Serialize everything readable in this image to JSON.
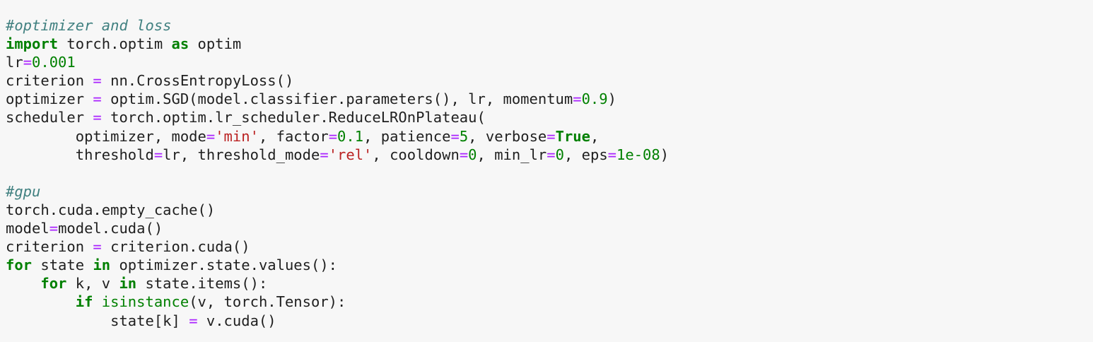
{
  "theme": {
    "background": "#f7f7f7",
    "text": "#1f1f1f",
    "comment": "#408080",
    "keyword": "#008000",
    "operator": "#aa22ff",
    "number": "#008000",
    "string": "#ba2121"
  },
  "code": {
    "language": "python",
    "lines": [
      [
        {
          "t": "comment",
          "v": "#optimizer and loss"
        }
      ],
      [
        {
          "t": "keyword",
          "v": "import"
        },
        {
          "t": "plain",
          "v": " torch.optim "
        },
        {
          "t": "keyword",
          "v": "as"
        },
        {
          "t": "plain",
          "v": " optim"
        }
      ],
      [
        {
          "t": "plain",
          "v": "lr"
        },
        {
          "t": "operator",
          "v": "="
        },
        {
          "t": "number",
          "v": "0.001"
        }
      ],
      [
        {
          "t": "plain",
          "v": "criterion "
        },
        {
          "t": "operator",
          "v": "="
        },
        {
          "t": "plain",
          "v": " nn.CrossEntropyLoss()"
        }
      ],
      [
        {
          "t": "plain",
          "v": "optimizer "
        },
        {
          "t": "operator",
          "v": "="
        },
        {
          "t": "plain",
          "v": " optim.SGD(model.classifier.parameters(), lr, momentum"
        },
        {
          "t": "operator",
          "v": "="
        },
        {
          "t": "number",
          "v": "0.9"
        },
        {
          "t": "plain",
          "v": ")"
        }
      ],
      [
        {
          "t": "plain",
          "v": "scheduler "
        },
        {
          "t": "operator",
          "v": "="
        },
        {
          "t": "plain",
          "v": " torch.optim.lr_scheduler.ReduceLROnPlateau("
        }
      ],
      [
        {
          "t": "plain",
          "v": "        optimizer, mode"
        },
        {
          "t": "operator",
          "v": "="
        },
        {
          "t": "string",
          "v": "'min'"
        },
        {
          "t": "plain",
          "v": ", factor"
        },
        {
          "t": "operator",
          "v": "="
        },
        {
          "t": "number",
          "v": "0.1"
        },
        {
          "t": "plain",
          "v": ", patience"
        },
        {
          "t": "operator",
          "v": "="
        },
        {
          "t": "number",
          "v": "5"
        },
        {
          "t": "plain",
          "v": ", verbose"
        },
        {
          "t": "operator",
          "v": "="
        },
        {
          "t": "keyword",
          "v": "True"
        },
        {
          "t": "plain",
          "v": ","
        }
      ],
      [
        {
          "t": "plain",
          "v": "        threshold"
        },
        {
          "t": "operator",
          "v": "="
        },
        {
          "t": "plain",
          "v": "lr, threshold_mode"
        },
        {
          "t": "operator",
          "v": "="
        },
        {
          "t": "string",
          "v": "'rel'"
        },
        {
          "t": "plain",
          "v": ", cooldown"
        },
        {
          "t": "operator",
          "v": "="
        },
        {
          "t": "number",
          "v": "0"
        },
        {
          "t": "plain",
          "v": ", min_lr"
        },
        {
          "t": "operator",
          "v": "="
        },
        {
          "t": "number",
          "v": "0"
        },
        {
          "t": "plain",
          "v": ", eps"
        },
        {
          "t": "operator",
          "v": "="
        },
        {
          "t": "number",
          "v": "1e-08"
        },
        {
          "t": "plain",
          "v": ")"
        }
      ],
      [],
      [
        {
          "t": "comment",
          "v": "#gpu"
        }
      ],
      [
        {
          "t": "plain",
          "v": "torch.cuda.empty_cache()"
        }
      ],
      [
        {
          "t": "plain",
          "v": "model"
        },
        {
          "t": "operator",
          "v": "="
        },
        {
          "t": "plain",
          "v": "model.cuda()"
        }
      ],
      [
        {
          "t": "plain",
          "v": "criterion "
        },
        {
          "t": "operator",
          "v": "="
        },
        {
          "t": "plain",
          "v": " criterion.cuda()"
        }
      ],
      [
        {
          "t": "keyword",
          "v": "for"
        },
        {
          "t": "plain",
          "v": " state "
        },
        {
          "t": "keyword",
          "v": "in"
        },
        {
          "t": "plain",
          "v": " optimizer.state.values():"
        }
      ],
      [
        {
          "t": "plain",
          "v": "    "
        },
        {
          "t": "keyword",
          "v": "for"
        },
        {
          "t": "plain",
          "v": " k, v "
        },
        {
          "t": "keyword",
          "v": "in"
        },
        {
          "t": "plain",
          "v": " state.items():"
        }
      ],
      [
        {
          "t": "plain",
          "v": "        "
        },
        {
          "t": "keyword",
          "v": "if"
        },
        {
          "t": "plain",
          "v": " "
        },
        {
          "t": "builtin",
          "v": "isinstance"
        },
        {
          "t": "plain",
          "v": "(v, torch.Tensor):"
        }
      ],
      [
        {
          "t": "plain",
          "v": "            state[k] "
        },
        {
          "t": "operator",
          "v": "="
        },
        {
          "t": "plain",
          "v": " v.cuda()"
        }
      ]
    ]
  }
}
